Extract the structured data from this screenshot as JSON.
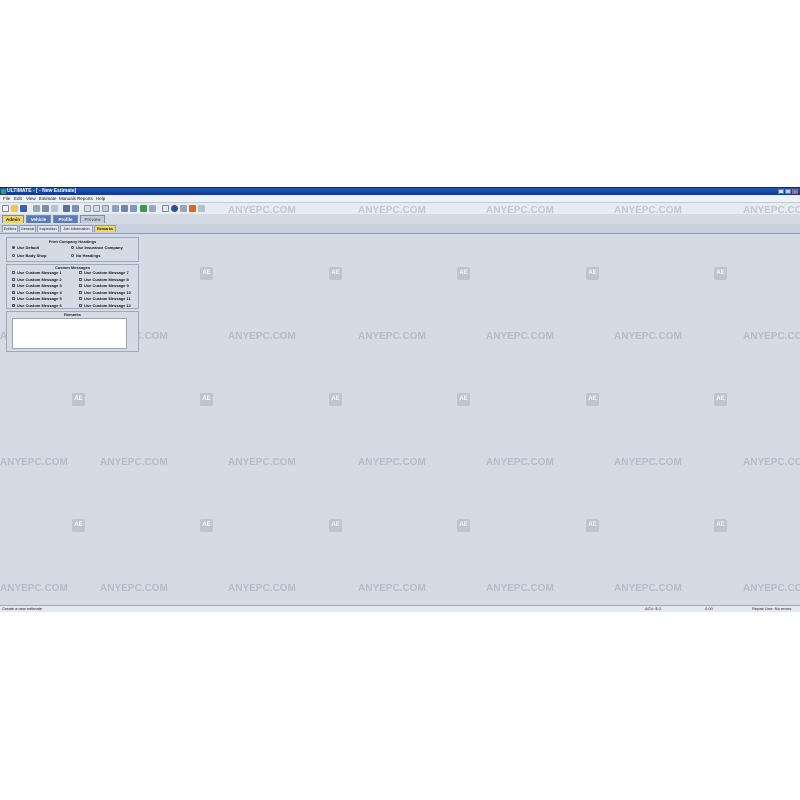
{
  "window": {
    "title": "ULTIMATE - [ - New Estimate]",
    "buttons": [
      "_",
      "□",
      "×"
    ]
  },
  "menu": [
    "File",
    "Edit",
    "View",
    "Estimate",
    "Manuals",
    "Reports",
    "Help"
  ],
  "main_tabs": [
    "Admin",
    "Vehicle",
    "Profile",
    "Preview"
  ],
  "sub_tabs": [
    "Entities",
    "General",
    "Inspection",
    "Job Information",
    "Remarks"
  ],
  "print_headings": {
    "title": "Print Company Headings",
    "options": [
      "Use Default",
      "Use Insurance Company",
      "Use Body Shop",
      "No Headings"
    ],
    "selected": "Use Default"
  },
  "custom_messages": {
    "title": "Custom Messages",
    "left": [
      "Use Custom Message 1",
      "Use Custom Message 2",
      "Use Custom Message 3",
      "Use Custom Message 4",
      "Use Custom Message 5",
      "Use Custom Message 6"
    ],
    "right": [
      "Use Custom Message 7",
      "Use Custom Message 8",
      "Use Custom Message 9",
      "Use Custom Message 10",
      "Use Custom Message 11",
      "Use Custom Message 12"
    ]
  },
  "remarks": {
    "title": "Remarks",
    "value": ""
  },
  "watermark": {
    "text": "ANYEPC.COM",
    "badge": "AE"
  },
  "status": {
    "left": "Create a new estimate",
    "acv": "ACV: $ 0",
    "amount": "0.00",
    "right": "Repair Line: No errors"
  },
  "colors": {
    "titlebar": "#1f57b8",
    "active_tab": "#f5d36b",
    "background": "#d5dbe5"
  }
}
